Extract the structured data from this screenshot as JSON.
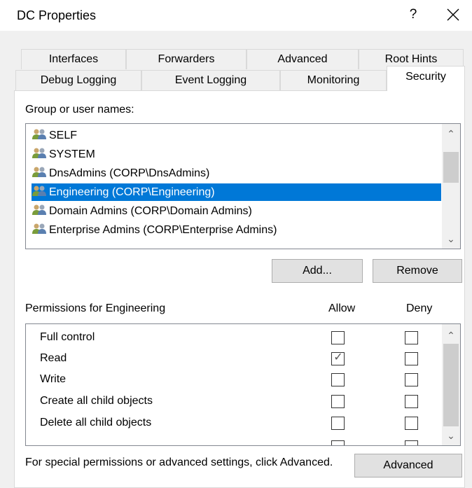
{
  "window": {
    "title": "DC Properties",
    "help_label": "?",
    "close_label": "✕"
  },
  "tabs": {
    "row1": [
      "Interfaces",
      "Forwarders",
      "Advanced",
      "Root Hints"
    ],
    "row2": [
      "Debug Logging",
      "Event Logging",
      "Monitoring",
      "Security"
    ],
    "active": "Security"
  },
  "groups": {
    "label": "Group or user names:",
    "items": [
      {
        "label": "SELF"
      },
      {
        "label": "SYSTEM"
      },
      {
        "label": "DnsAdmins (CORP\\DnsAdmins)"
      },
      {
        "label": "Engineering (CORP\\Engineering)",
        "selected": true
      },
      {
        "label": "Domain Admins (CORP\\Domain Admins)"
      },
      {
        "label": "Enterprise Admins (CORP\\Enterprise Admins)"
      }
    ],
    "add_label": "Add...",
    "remove_label": "Remove"
  },
  "permissions": {
    "label": "Permissions for Engineering",
    "allow_label": "Allow",
    "deny_label": "Deny",
    "rows": [
      {
        "name": "Full control",
        "allow": false,
        "deny": false
      },
      {
        "name": "Read",
        "allow": true,
        "deny": false
      },
      {
        "name": "Write",
        "allow": false,
        "deny": false
      },
      {
        "name": "Create all child objects",
        "allow": false,
        "deny": false
      },
      {
        "name": "Delete all child objects",
        "allow": false,
        "deny": false
      }
    ]
  },
  "footer": {
    "note": "For special permissions or advanced settings, click Advanced.",
    "advanced_label": "Advanced"
  },
  "colors": {
    "selection": "#0078d7",
    "dialog_bg": "#f0f0f0",
    "button_bg": "#e1e1e1"
  },
  "icons": {
    "group": "users-group-icon",
    "check": "checkmark-icon"
  }
}
